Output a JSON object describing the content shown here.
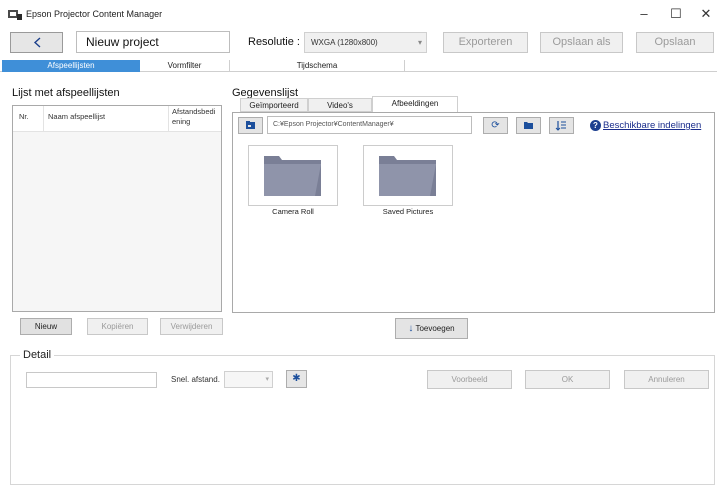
{
  "window": {
    "title": "Epson Projector Content Manager",
    "controls": [
      "–",
      "☐",
      "✕"
    ]
  },
  "toolbar": {
    "back_icon": "chevron-left-icon",
    "project_name": "Nieuw project",
    "resolution_label": "Resolutie :",
    "resolution_value": "WXGA (1280x800)",
    "export_label": "Exporteren",
    "save_as_label": "Opslaan als",
    "save_label": "Opslaan"
  },
  "main_tabs": [
    "Afspeellijsten",
    "Vormfilter",
    "Tijdschema"
  ],
  "playlists": {
    "title": "Lijst met afspeellijsten",
    "columns": [
      "Nr.",
      "Naam afspeellijst",
      "Afstandsbedi ening"
    ],
    "rows": [],
    "new_label": "Nieuw",
    "copy_label": "Kopiëren",
    "delete_label": "Verwijderen"
  },
  "data_list": {
    "title": "Gegevenslijst",
    "tabs": [
      "Geïmporteerd",
      "Video's",
      "Afbeeldingen"
    ],
    "active_tab": "Afbeeldingen",
    "path": "C:¥Epson Projector¥ContentManager¥",
    "help_link": "Beschikbare indelingen",
    "folders": [
      "Camera Roll",
      "Saved Pictures"
    ],
    "add_label": "Toevoegen"
  },
  "detail": {
    "title": "Detail",
    "shortcut_label": "Snel. afstand.",
    "preview_label": "Voorbeeld",
    "ok_label": "OK",
    "cancel_label": "Annuleren"
  },
  "colors": {
    "accent": "#3f8fd8",
    "link": "#1a2d8c",
    "folder": "#7a7f96"
  }
}
